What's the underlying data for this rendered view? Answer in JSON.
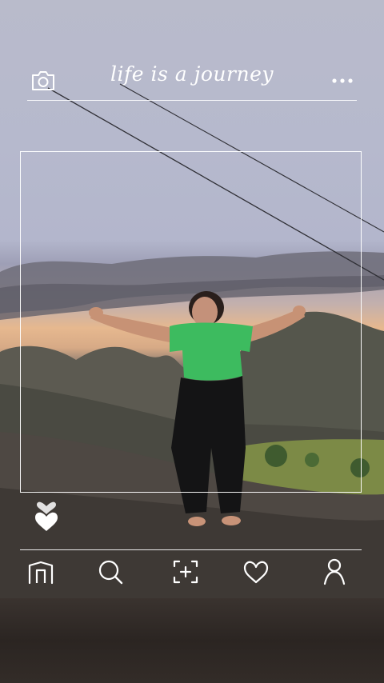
{
  "header": {
    "title": "life is a journey",
    "camera_icon": "camera-icon",
    "more_icon": "more-dots-icon"
  },
  "post": {
    "like_icon": "heart-stack-icon"
  },
  "bottom_nav": {
    "items": [
      {
        "icon": "home-icon"
      },
      {
        "icon": "search-icon"
      },
      {
        "icon": "add-photo-icon"
      },
      {
        "icon": "heart-icon"
      },
      {
        "icon": "profile-icon"
      }
    ]
  },
  "colors": {
    "overlay": "#ffffff",
    "shirt": "#3dbb5f",
    "sky_top": "#b9bbcb",
    "sunset": "#e6b88f"
  }
}
